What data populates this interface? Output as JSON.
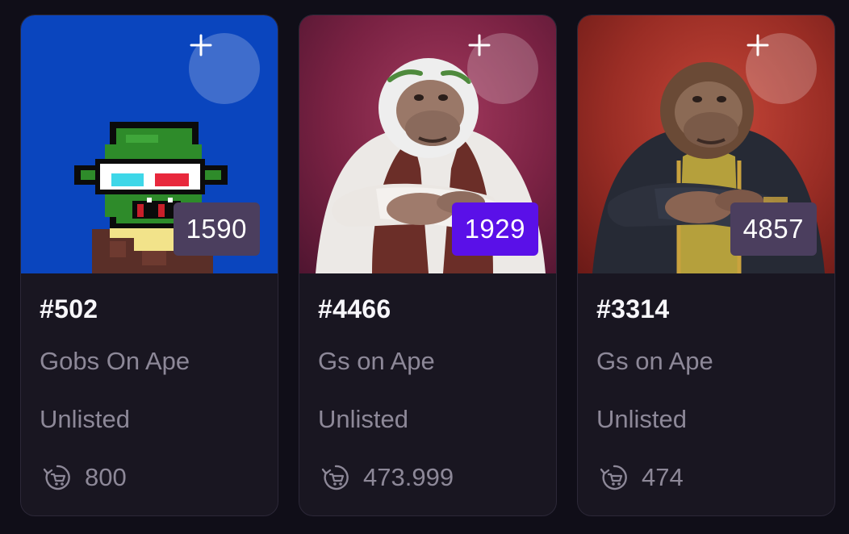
{
  "cards": [
    {
      "title": "#502",
      "collection": "Gobs On Ape",
      "status": "Unlisted",
      "price": "800",
      "rank": "1590",
      "rank_style": "muted",
      "image": "pixel-goblin-image"
    },
    {
      "title": "#4466",
      "collection": "Gs on Ape",
      "status": "Unlisted",
      "price": "473.999",
      "rank": "1929",
      "rank_style": "highlight",
      "image": "white-ape-vest-image"
    },
    {
      "title": "#3314",
      "collection": "Gs on Ape",
      "status": "Unlisted",
      "price": "474",
      "rank": "4857",
      "rank_style": "muted",
      "image": "brown-ape-jacket-image"
    }
  ],
  "icons": {
    "add": "plus-icon",
    "price": "cart-refresh-icon"
  },
  "colors": {
    "background": "#100e18",
    "card": "#191621",
    "rank_muted": "#4b3e5e",
    "rank_highlight": "#5a10e8",
    "text": "#f7f6fa",
    "muted_text": "#8d8898"
  }
}
